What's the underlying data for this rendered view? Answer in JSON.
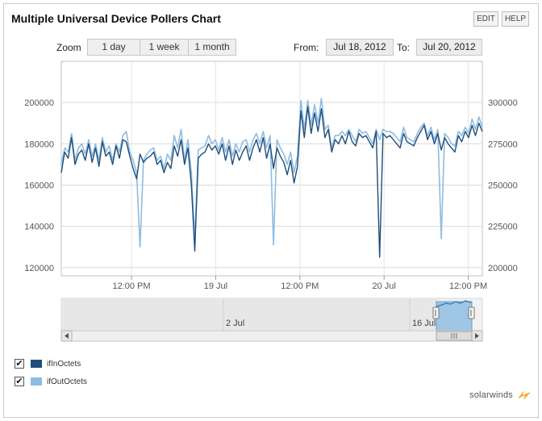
{
  "header": {
    "title": "Multiple Universal Device Pollers Chart",
    "edit_label": "EDIT",
    "help_label": "HELP"
  },
  "zoom": {
    "label": "Zoom",
    "options": [
      "1 day",
      "1 week",
      "1 month"
    ]
  },
  "range": {
    "from_label": "From:",
    "from_value": "Jul 18, 2012",
    "to_label": "To:",
    "to_value": "Jul 20, 2012"
  },
  "legend": {
    "items": [
      {
        "label": "ifInOctets",
        "checked": true,
        "check_glyph": "✔",
        "color": "#1f4e7a"
      },
      {
        "label": "ifOutOctets",
        "checked": true,
        "check_glyph": "✔",
        "color": "#8fbce0"
      }
    ]
  },
  "navigator": {
    "labels": [
      "2 Jul",
      "16 Jul"
    ],
    "window_start": 0.9,
    "window_end": 1.0
  },
  "brand": {
    "name": "solarwinds",
    "mark_color": "#f5a623"
  },
  "chart_data": {
    "type": "line",
    "x_start": "Jul 18, 2012 02:00",
    "x_end": "Jul 20, 2012 14:00",
    "x_tick_labels": [
      "12:00 PM",
      "19 Jul",
      "12:00 PM",
      "20 Jul",
      "12:00 PM"
    ],
    "x_tick_dates": [
      "Jul 18, 2012 12:00",
      "Jul 19, 2012 00:00",
      "Jul 19, 2012 12:00",
      "Jul 20, 2012 00:00",
      "Jul 20, 2012 12:00"
    ],
    "y_left_ticks": [
      120000,
      140000,
      160000,
      180000,
      200000
    ],
    "y_left_range": [
      116000,
      220000
    ],
    "y_right_ticks": [
      200000,
      225000,
      250000,
      275000,
      300000
    ],
    "y_right_range": [
      195000,
      325000
    ],
    "grid": true,
    "series": [
      {
        "name": "ifInOctets",
        "axis": "left",
        "color": "#1f4e7a",
        "values": [
          166000,
          176000,
          173000,
          183000,
          170000,
          175000,
          177000,
          172000,
          180000,
          171000,
          178000,
          169000,
          181000,
          174000,
          176000,
          170000,
          179000,
          173000,
          182000,
          181000,
          174000,
          168000,
          163000,
          175000,
          171000,
          173000,
          174000,
          176000,
          170000,
          172000,
          166000,
          171000,
          168000,
          179000,
          174000,
          182000,
          170000,
          178000,
          160000,
          128000,
          173000,
          175000,
          176000,
          180000,
          177000,
          179000,
          175000,
          180000,
          172000,
          179000,
          170000,
          177000,
          172000,
          176000,
          179000,
          172000,
          178000,
          182000,
          176000,
          183000,
          173000,
          180000,
          168000,
          178000,
          174000,
          171000,
          165000,
          172000,
          161000,
          169000,
          196000,
          183000,
          198000,
          185000,
          195000,
          186000,
          197000,
          183000,
          187000,
          176000,
          182000,
          180000,
          184000,
          180000,
          186000,
          181000,
          179000,
          185000,
          183000,
          184000,
          181000,
          178000,
          186000,
          125000,
          185000,
          183000,
          184000,
          182000,
          180000,
          178000,
          185000,
          181000,
          180000,
          179000,
          183000,
          186000,
          189000,
          182000,
          186000,
          180000,
          185000,
          177000,
          183000,
          180000,
          178000,
          176000,
          184000,
          181000,
          186000,
          183000,
          189000,
          184000,
          190000,
          186000
        ],
        "note": ""
      },
      {
        "name": "ifOutOctets",
        "axis": "left",
        "color": "#8fbce0",
        "values": [
          170000,
          178000,
          176000,
          185000,
          172000,
          178000,
          180000,
          175000,
          182000,
          174000,
          180000,
          172000,
          183000,
          176000,
          179000,
          172000,
          180000,
          176000,
          184000,
          186000,
          176000,
          172000,
          166000,
          130000,
          172000,
          175000,
          177000,
          178000,
          172000,
          174000,
          168000,
          175000,
          172000,
          184000,
          178000,
          187000,
          172000,
          182000,
          166000,
          134000,
          177000,
          178000,
          179000,
          184000,
          180000,
          182000,
          177000,
          183000,
          176000,
          182000,
          174000,
          180000,
          176000,
          181000,
          182000,
          176000,
          182000,
          185000,
          180000,
          186000,
          178000,
          184000,
          131000,
          182000,
          178000,
          175000,
          170000,
          176000,
          166000,
          174000,
          201000,
          187000,
          201000,
          189000,
          199000,
          190000,
          202000,
          187000,
          189000,
          178000,
          184000,
          184000,
          186000,
          184000,
          187000,
          184000,
          181000,
          187000,
          185000,
          186000,
          183000,
          180000,
          187000,
          182000,
          187000,
          186000,
          186000,
          185000,
          183000,
          181000,
          188000,
          183000,
          182000,
          181000,
          185000,
          188000,
          190000,
          184000,
          188000,
          182000,
          187000,
          134000,
          185000,
          183000,
          180000,
          179000,
          186000,
          184000,
          188000,
          185000,
          192000,
          187000,
          193000,
          188000
        ],
        "note": ""
      }
    ]
  }
}
